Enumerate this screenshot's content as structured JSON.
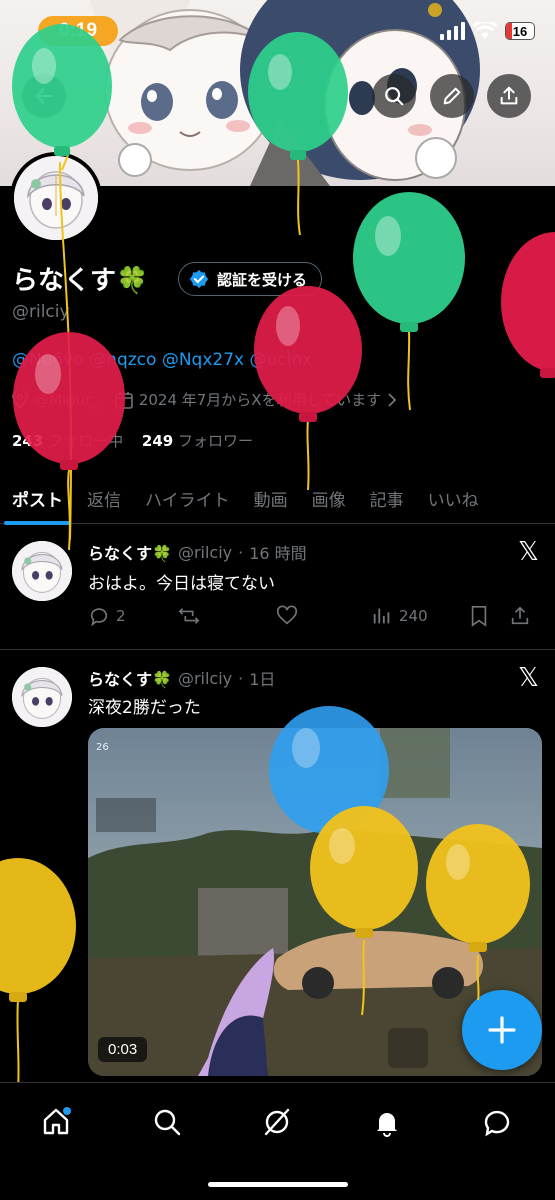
{
  "status_bar": {
    "time": "0:19",
    "battery": "16"
  },
  "profile": {
    "display_name": "らなくす🍀",
    "verify_label": "認証を受ける",
    "handle": "@rilciy",
    "bio_links": "@Nu6vo @nqzco @Nqx27x @uclnx",
    "location": "@Migur_",
    "joined": "2024 年7月からXを利用しています",
    "following_count": "243",
    "following_label": "フォロー中",
    "followers_count": "249",
    "followers_label": "フォロワー"
  },
  "tabs": [
    {
      "label": "ポスト",
      "active": true
    },
    {
      "label": "返信"
    },
    {
      "label": "ハイライト"
    },
    {
      "label": "動画"
    },
    {
      "label": "画像"
    },
    {
      "label": "記事"
    },
    {
      "label": "いいね"
    }
  ],
  "posts": [
    {
      "name": "らなくす🍀",
      "handle": "@rilciy",
      "time": "16 時間",
      "text": "おはよ。今日は寝てない",
      "replies": "2",
      "views": "240"
    },
    {
      "name": "らなくす🍀",
      "handle": "@rilciy",
      "time": "1日",
      "text": "深夜2勝だった",
      "video_duration": "0:03"
    }
  ],
  "nav": [
    "home-icon",
    "search-icon",
    "grok-icon",
    "notifications-icon",
    "messages-icon"
  ],
  "colors": {
    "accent": "#1d9bf0",
    "background": "#000000",
    "muted": "#71767b",
    "border": "#2f3336"
  }
}
